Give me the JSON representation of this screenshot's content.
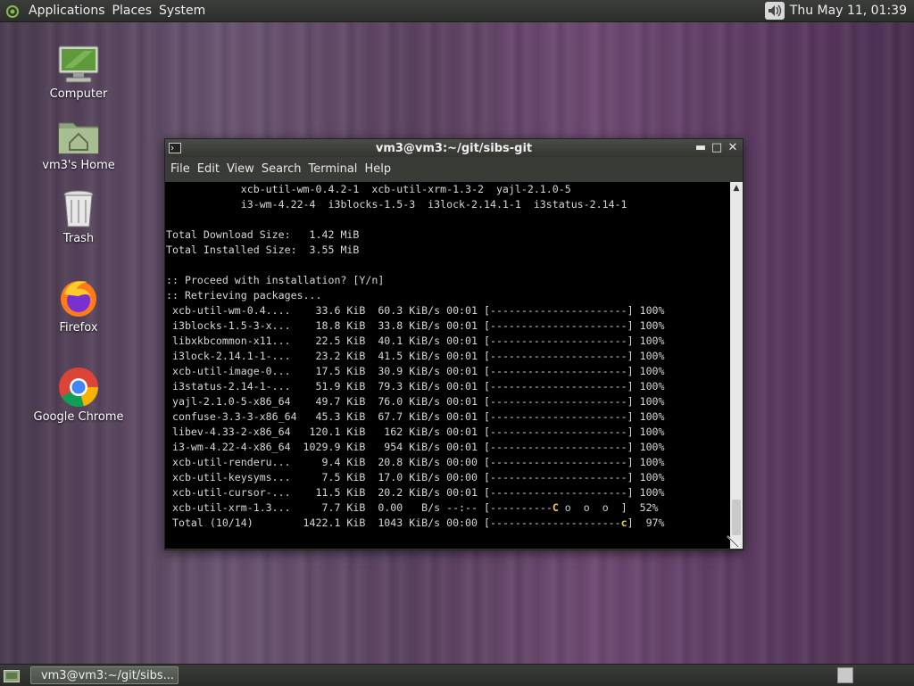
{
  "top_panel": {
    "menus": [
      "Applications",
      "Places",
      "System"
    ],
    "clock": "Thu May 11, 01:39"
  },
  "desktop": {
    "icons": [
      "Computer",
      "vm3's Home",
      "Trash",
      "Firefox",
      "Google Chrome"
    ]
  },
  "window": {
    "title": "vm3@vm3:~/git/sibs-git",
    "menus": [
      "File",
      "Edit",
      "View",
      "Search",
      "Terminal",
      "Help"
    ]
  },
  "terminal": {
    "pre_lines": [
      "            xcb-util-wm-0.4.2-1  xcb-util-xrm-1.3-2  yajl-2.1.0-5",
      "            i3-wm-4.22-4  i3blocks-1.5-3  i3lock-2.14.1-1  i3status-2.14-1",
      "",
      "Total Download Size:   1.42 MiB",
      "Total Installed Size:  3.55 MiB",
      "",
      ":: Proceed with installation? [Y/n]",
      ":: Retrieving packages..."
    ],
    "packages": [
      {
        "name": "xcb-util-wm-0.4....",
        "size": "33.6 KiB",
        "speed": "60.3 KiB/s",
        "time": "00:01",
        "bar": "[----------------------]",
        "pct": "100%"
      },
      {
        "name": "i3blocks-1.5-3-x...",
        "size": "18.8 KiB",
        "speed": "33.8 KiB/s",
        "time": "00:01",
        "bar": "[----------------------]",
        "pct": "100%"
      },
      {
        "name": "libxkbcommon-x11...",
        "size": "22.5 KiB",
        "speed": "40.1 KiB/s",
        "time": "00:01",
        "bar": "[----------------------]",
        "pct": "100%"
      },
      {
        "name": "i3lock-2.14.1-1-...",
        "size": "23.2 KiB",
        "speed": "41.5 KiB/s",
        "time": "00:01",
        "bar": "[----------------------]",
        "pct": "100%"
      },
      {
        "name": "xcb-util-image-0...",
        "size": "17.5 KiB",
        "speed": "30.9 KiB/s",
        "time": "00:01",
        "bar": "[----------------------]",
        "pct": "100%"
      },
      {
        "name": "i3status-2.14-1-...",
        "size": "51.9 KiB",
        "speed": "79.3 KiB/s",
        "time": "00:01",
        "bar": "[----------------------]",
        "pct": "100%"
      },
      {
        "name": "yajl-2.1.0-5-x86_64",
        "size": "49.7 KiB",
        "speed": "76.0 KiB/s",
        "time": "00:01",
        "bar": "[----------------------]",
        "pct": "100%"
      },
      {
        "name": "confuse-3.3-3-x86_64",
        "size": "45.3 KiB",
        "speed": "67.7 KiB/s",
        "time": "00:01",
        "bar": "[----------------------]",
        "pct": "100%"
      },
      {
        "name": "libev-4.33-2-x86_64",
        "size": "120.1 KiB",
        "speed": "162 KiB/s",
        "time": "00:01",
        "bar": "[----------------------]",
        "pct": "100%"
      },
      {
        "name": "i3-wm-4.22-4-x86_64",
        "size": "1029.9 KiB",
        "speed": "954 KiB/s",
        "time": "00:01",
        "bar": "[----------------------]",
        "pct": "100%"
      },
      {
        "name": "xcb-util-renderu...",
        "size": "9.4 KiB",
        "speed": "20.8 KiB/s",
        "time": "00:00",
        "bar": "[----------------------]",
        "pct": "100%"
      },
      {
        "name": "xcb-util-keysyms...",
        "size": "7.5 KiB",
        "speed": "17.0 KiB/s",
        "time": "00:00",
        "bar": "[----------------------]",
        "pct": "100%"
      },
      {
        "name": "xcb-util-cursor-...",
        "size": "11.5 KiB",
        "speed": "20.2 KiB/s",
        "time": "00:01",
        "bar": "[----------------------]",
        "pct": "100%"
      },
      {
        "name": "xcb-util-xrm-1.3...",
        "size": "7.7 KiB",
        "speed": "0.00   B/s",
        "time": "--:--",
        "bar": "[----------C o  o  o  ]",
        "pct": "52%"
      }
    ],
    "total": {
      "name": "Total (10/14)",
      "size": "1422.1 KiB",
      "speed": "1043 KiB/s",
      "time": "00:00",
      "bar": "[---------------------c]",
      "pct": "97%"
    }
  },
  "taskbar": {
    "terminal_task": "vm3@vm3:~/git/sibs..."
  },
  "icons": {
    "top_logo": "gnome-foot-icon",
    "volume": "speaker-icon",
    "show_desktop": "show-desktop-icon",
    "terminal": "terminal-icon"
  }
}
